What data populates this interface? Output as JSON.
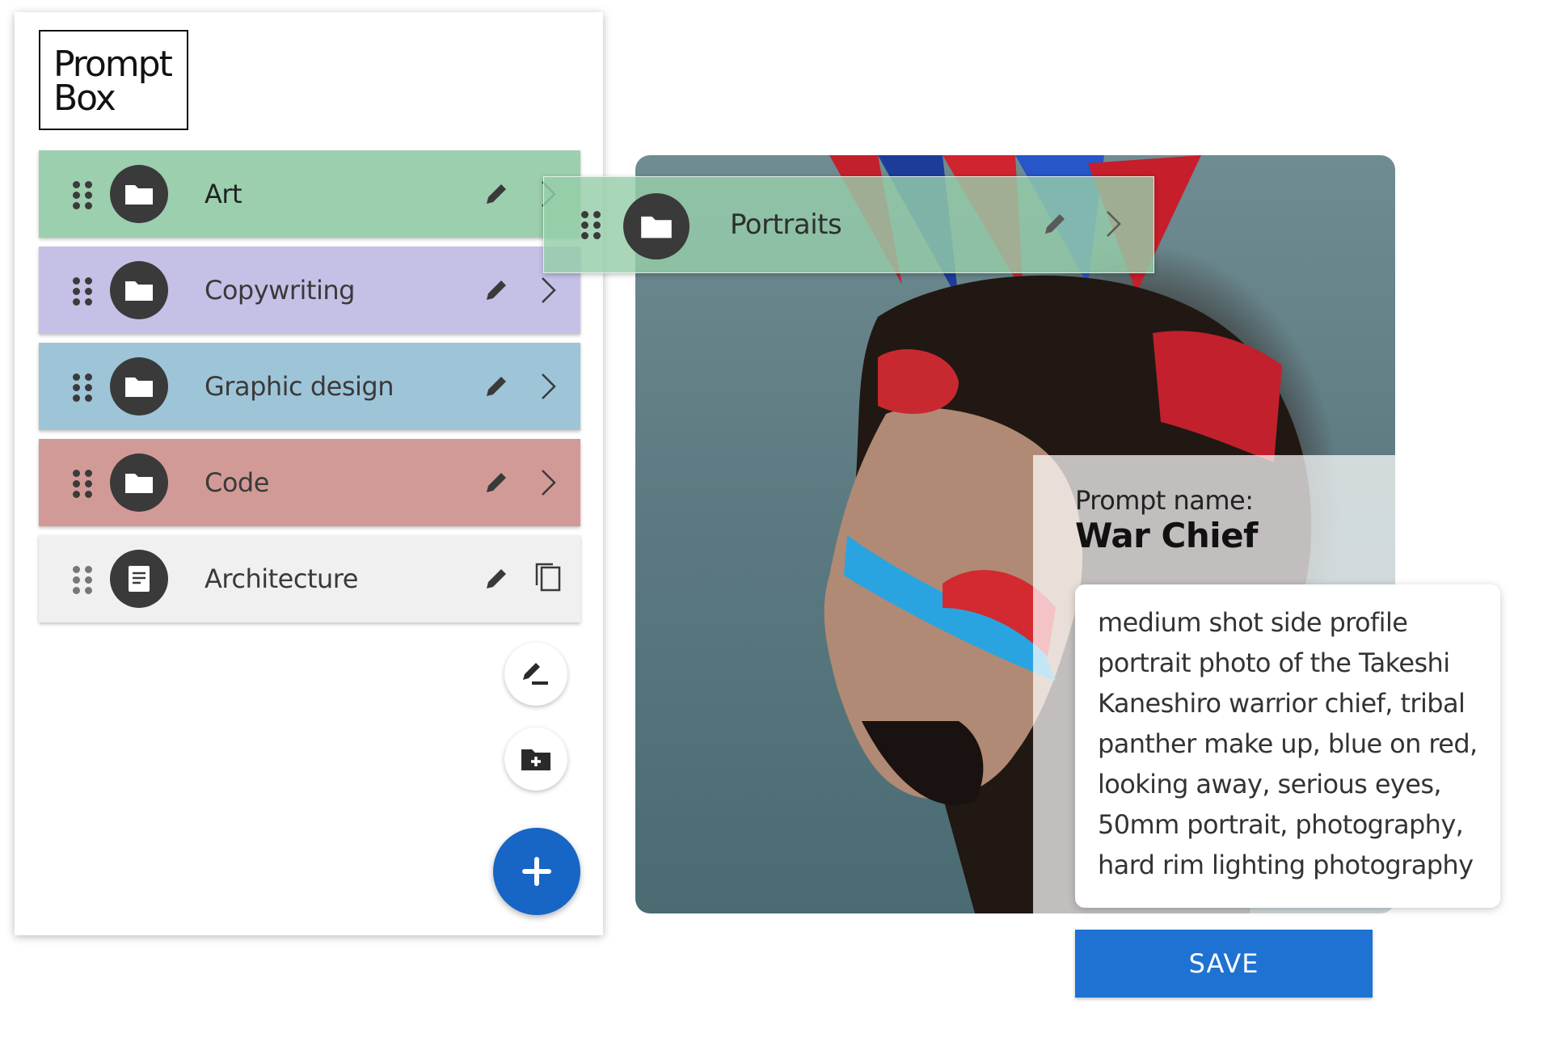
{
  "logo": {
    "line1": "Prompt",
    "line2": "Box"
  },
  "folders": [
    {
      "label": "Art",
      "color": "#9bcfae",
      "icon": "folder-icon",
      "action": "chevron-right-icon"
    },
    {
      "label": "Copywriting",
      "color": "#c5c0e6",
      "icon": "folder-icon",
      "action": "chevron-right-icon"
    },
    {
      "label": "Graphic design",
      "color": "#9ec4d8",
      "icon": "folder-icon",
      "action": "chevron-right-icon"
    },
    {
      "label": "Code",
      "color": "#d29a96",
      "icon": "folder-icon",
      "action": "chevron-right-icon"
    },
    {
      "label": "Architecture",
      "color": "#f0f0f0",
      "icon": "document-icon",
      "action": "copy-icon"
    }
  ],
  "dragging_folder": {
    "label": "Portraits",
    "color": "#9bcfae"
  },
  "actions": {
    "new_prompt_icon": "edit-note-icon",
    "new_folder_icon": "create-folder-icon",
    "add_icon": "plus-icon"
  },
  "prompt": {
    "name_label": "Prompt name:",
    "name": "War Chief",
    "text": "medium shot side profile portrait photo of the Takeshi Kaneshiro warrior chief, tribal panther make up, blue on red, looking away, serious eyes, 50mm portrait, photography, hard rim lighting photography"
  },
  "save_label": "SAVE",
  "colors": {
    "accent": "#1e72d2",
    "fab": "#1765c5"
  }
}
